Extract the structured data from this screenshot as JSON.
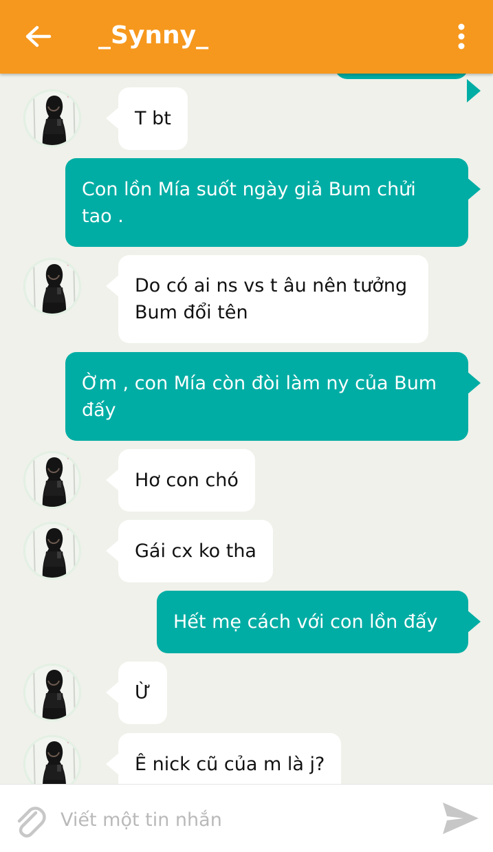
{
  "header": {
    "title": "_Synny_",
    "back_icon": "arrow-left-icon",
    "menu_icon": "more-vertical-icon",
    "color": "#f6981d"
  },
  "colors": {
    "outgoing_bubble": "#00ada4",
    "incoming_bubble": "#ffffff",
    "background": "#eff1ea"
  },
  "messages": [
    {
      "direction": "in",
      "text": "T bt"
    },
    {
      "direction": "out",
      "text": "Con lồn Mía suốt ngày giả Bum chửi tao ."
    },
    {
      "direction": "in",
      "text": "Do có ai ns vs t âu nên tưởng Bum đổi tên"
    },
    {
      "direction": "out",
      "text": "Ờm , con Mía còn đòi làm ny của Bum đấy"
    },
    {
      "direction": "in",
      "text": "Hơ con chó"
    },
    {
      "direction": "in",
      "text": "Gái cx ko tha"
    },
    {
      "direction": "out",
      "text": "Hết mẹ cách với con lồn đấy"
    },
    {
      "direction": "in",
      "text": "Ừ"
    },
    {
      "direction": "in",
      "text": "Ê nick cũ của m là j?"
    }
  ],
  "composer": {
    "placeholder": "Viết một tin nhắn",
    "attach_icon": "paperclip-icon",
    "send_icon": "send-icon"
  }
}
